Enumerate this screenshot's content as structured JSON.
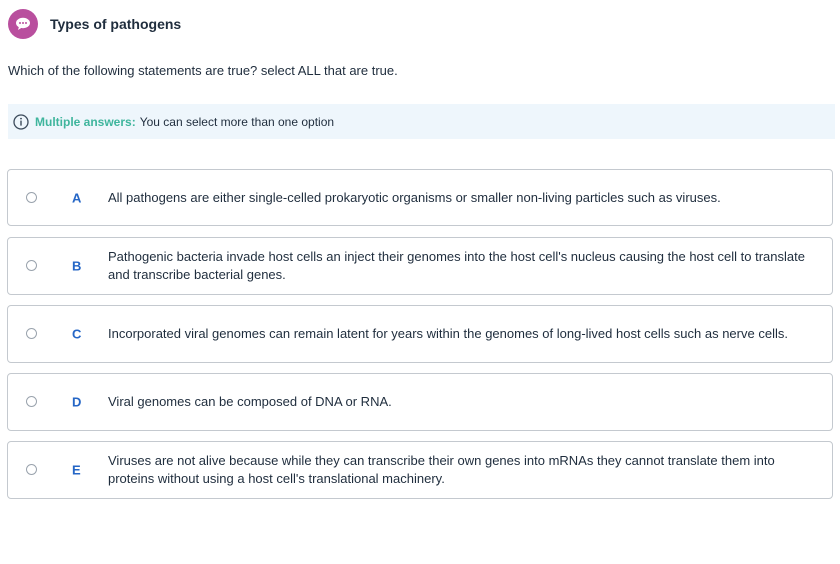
{
  "header": {
    "title": "Types of pathogens",
    "icon": "chat-bubble-icon",
    "icon_color": "#b94f9e"
  },
  "question": "Which of the following statements are true? select ALL that are true.",
  "info": {
    "label": "Multiple answers:",
    "text": "You can select more than one option",
    "label_color": "#3fb59d"
  },
  "options": [
    {
      "letter": "A",
      "text": "All pathogens are either single-celled prokaryotic organisms or smaller non-living particles such as viruses."
    },
    {
      "letter": "B",
      "text": "Pathogenic bacteria invade host cells an inject their genomes into the host cell's nucleus causing the host cell to translate and transcribe bacterial genes."
    },
    {
      "letter": "C",
      "text": "Incorporated viral genomes can remain latent for years within the genomes of long-lived host cells such as nerve cells."
    },
    {
      "letter": "D",
      "text": "Viral genomes can be composed of DNA or RNA."
    },
    {
      "letter": "E",
      "text": "Viruses are not alive because while they can transcribe their own genes into mRNAs they cannot translate them into proteins without using a host cell's translational machinery."
    }
  ],
  "accent_color": "#2566c6"
}
